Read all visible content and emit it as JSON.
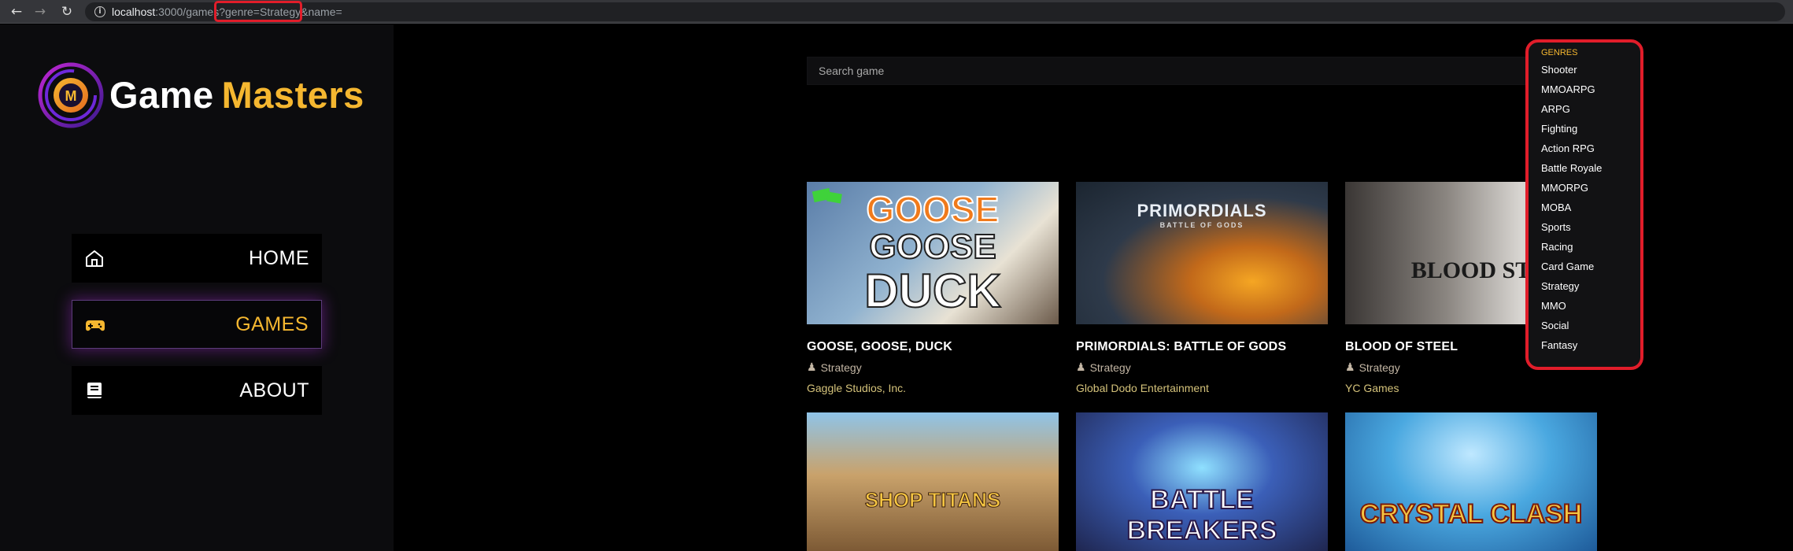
{
  "browser": {
    "url_host": "localhost",
    "url_rest": ":3000/games?genre=Strategy&name="
  },
  "brand": {
    "part1": "Game",
    "part2": "Masters"
  },
  "nav": {
    "home": "HOME",
    "games": "GAMES",
    "about": "ABOUT"
  },
  "search": {
    "placeholder": "Search game"
  },
  "genres": {
    "header": "GENRES",
    "items": [
      "Shooter",
      "MMOARPG",
      "ARPG",
      "Fighting",
      "Action RPG",
      "Battle Royale",
      "MMORPG",
      "MOBA",
      "Sports",
      "Racing",
      "Card Game",
      "Strategy",
      "MMO",
      "Social",
      "Fantasy"
    ]
  },
  "games": [
    {
      "title": "GOOSE, GOOSE, DUCK",
      "genre": "Strategy",
      "developer": "Gaggle Studios, Inc.",
      "art": "GOOSE GOOSE DUCK"
    },
    {
      "title": "PRIMORDIALS: BATTLE OF GODS",
      "genre": "Strategy",
      "developer": "Global Dodo Entertainment",
      "art": "PRIMORDIALS"
    },
    {
      "title": "BLOOD OF STEEL",
      "genre": "Strategy",
      "developer": "YC Games",
      "art": "BLOOD STEEL"
    },
    {
      "art": "SHOP TITANS"
    },
    {
      "art": "BATTLE BREAKERS"
    },
    {
      "art": "CRYSTAL CLASH"
    }
  ],
  "colors": {
    "accent": "#f5b730",
    "highlight": "#e11d2a",
    "sidebar_bg": "#0c0c0e"
  }
}
